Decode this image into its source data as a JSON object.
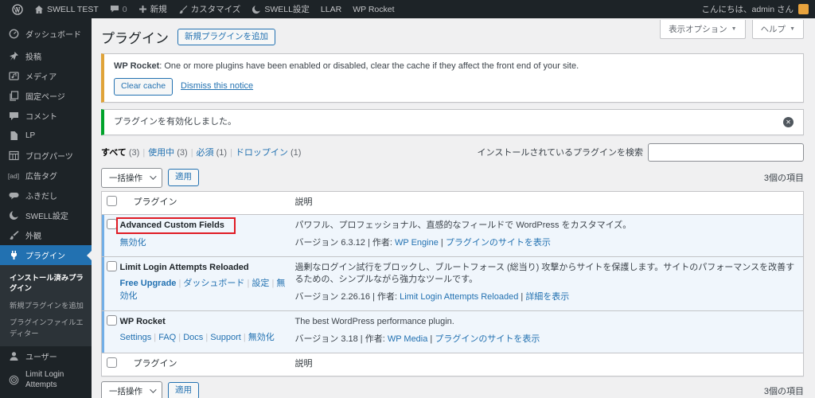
{
  "colors": {
    "accent": "#2271b1",
    "active_row_bg": "#f0f6fc",
    "active_row_border": "#72aee6",
    "warning_border": "#dfa339",
    "success_border": "#00a32a",
    "annotation": "#e01b24",
    "avatar": "#e8a33d"
  },
  "admin_bar": {
    "site_name": "SWELL TEST",
    "comments_count": "0",
    "new_label": "新規",
    "customize_label": "カスタマイズ",
    "swell_label": "SWELL設定",
    "llar_label": "LLAR",
    "wp_rocket_label": "WP Rocket",
    "greeting": "こんにちは、admin さん"
  },
  "sidebar": {
    "items": [
      {
        "label": "ダッシュボード"
      },
      {
        "label": "投稿"
      },
      {
        "label": "メディア"
      },
      {
        "label": "固定ページ"
      },
      {
        "label": "コメント"
      },
      {
        "label": "LP"
      },
      {
        "label": "ブログパーツ"
      },
      {
        "label": "広告タグ"
      },
      {
        "label": "ふきだし"
      },
      {
        "label": "SWELL設定"
      },
      {
        "label": "外観"
      },
      {
        "label": "プラグイン"
      }
    ],
    "submenu": {
      "installed": "インストール済みプラグイン",
      "add_new": "新規プラグインを追加",
      "file_editor": "プラグインファイルエディター"
    },
    "users": "ユーザー",
    "llar": "Limit Login Attempts"
  },
  "header": {
    "title": "プラグイン",
    "add_new_button": "新規プラグインを追加",
    "screen_options": "表示オプション",
    "help": "ヘルプ"
  },
  "notices": {
    "warning": {
      "prefix": "WP Rocket",
      "text": ": One or more plugins have been enabled or disabled, clear the cache if they affect the front end of your site.",
      "clear_cache_button": "Clear cache",
      "dismiss_link": "Dismiss this notice"
    },
    "success": {
      "text": "プラグインを有効化しました。"
    }
  },
  "filters": {
    "all": "すべて",
    "all_count": "(3)",
    "active": "使用中",
    "active_count": "(3)",
    "mustuse": "必須",
    "mustuse_count": "(1)",
    "dropins": "ドロップイン",
    "dropins_count": "(1)"
  },
  "search": {
    "label": "インストールされているプラグインを検索",
    "value": ""
  },
  "bulk": {
    "select_label": "一括操作",
    "apply_button": "適用",
    "items_count": "3個の項目"
  },
  "table": {
    "columns": {
      "name": "プラグイン",
      "description": "説明"
    },
    "rows": [
      {
        "name": "Advanced Custom Fields",
        "annotated": true,
        "actions": [
          {
            "label": "無効化"
          }
        ],
        "description": "パワフル、プロフェッショナル、直感的なフィールドで WordPress をカスタマイズ。",
        "version": "バージョン 6.3.12",
        "author_label": "作者: ",
        "author_link": "WP Engine",
        "site_link": "プラグインのサイトを表示"
      },
      {
        "name": "Limit Login Attempts Reloaded",
        "annotated": false,
        "actions": [
          {
            "label": "Free Upgrade",
            "bold": true
          },
          {
            "label": "ダッシュボード"
          },
          {
            "label": "設定"
          },
          {
            "label": "無効化"
          }
        ],
        "description": "過剰なログイン試行をブロックし、ブルートフォース (総当り) 攻撃からサイトを保護します。サイトのパフォーマンスを改善するための、シンプルながら強力なツールです。",
        "version": "バージョン 2.26.16",
        "author_label": "作者: ",
        "author_link": "Limit Login Attempts Reloaded",
        "site_link": "詳細を表示"
      },
      {
        "name": "WP Rocket",
        "annotated": false,
        "actions": [
          {
            "label": "Settings"
          },
          {
            "label": "FAQ"
          },
          {
            "label": "Docs"
          },
          {
            "label": "Support"
          },
          {
            "label": "無効化"
          }
        ],
        "description": "The best WordPress performance plugin.",
        "version": "バージョン 3.18",
        "author_label": "作者: ",
        "author_link": "WP Media",
        "site_link": "プラグインのサイトを表示"
      }
    ]
  }
}
